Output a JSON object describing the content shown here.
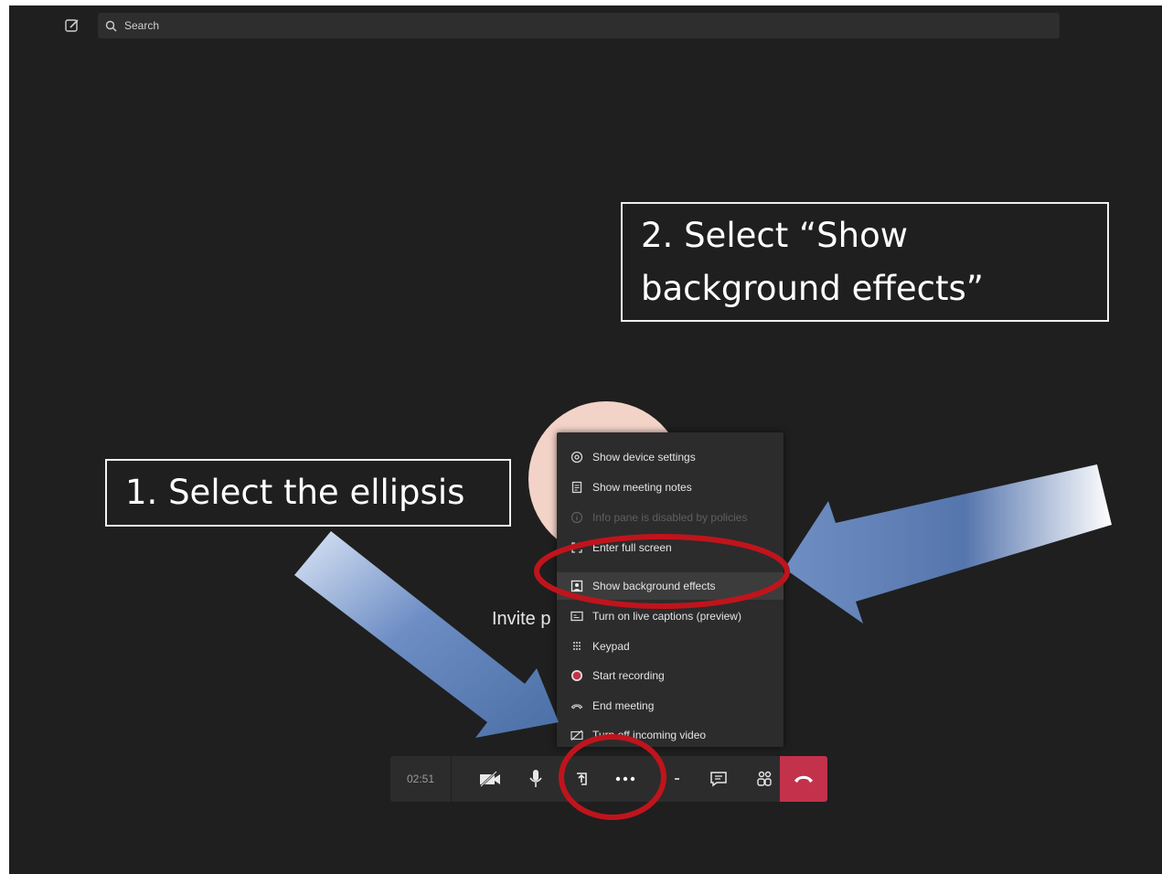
{
  "search": {
    "placeholder": "Search"
  },
  "callouts": {
    "step2_line1": "2. Select “Show",
    "step2_line2": "background effects”",
    "step1": "1. Select the ellipsis"
  },
  "stage": {
    "invite_text": "Invite p"
  },
  "menu": {
    "items": [
      {
        "label": "Show device settings",
        "icon": "gear-icon",
        "disabled": false
      },
      {
        "label": "Show meeting notes",
        "icon": "notes-icon",
        "disabled": false
      },
      {
        "label": "Info pane is disabled by policies",
        "icon": "info-icon",
        "disabled": true
      },
      {
        "label": "Enter full screen",
        "icon": "fullscreen-icon",
        "disabled": false
      },
      {
        "label": "Show background effects",
        "icon": "background-effects-icon",
        "disabled": false
      },
      {
        "label": "Turn on live captions (preview)",
        "icon": "captions-icon",
        "disabled": false
      },
      {
        "label": "Keypad",
        "icon": "keypad-icon",
        "disabled": false
      },
      {
        "label": "Start recording",
        "icon": "record-icon",
        "disabled": false
      },
      {
        "label": "End meeting",
        "icon": "end-meeting-icon",
        "disabled": false
      },
      {
        "label": "Turn off incoming video",
        "icon": "video-off-icon",
        "disabled": false
      }
    ]
  },
  "toolbar": {
    "timer": "02:51",
    "buttons": [
      "camera-off-icon",
      "microphone-icon",
      "share-icon",
      "more-options-icon",
      "raise-hand-icon",
      "chat-icon",
      "participants-icon",
      "hang-up-icon"
    ]
  },
  "colors": {
    "background": "#1f1f1f",
    "hangup": "#c4314b",
    "highlight_ring": "#c0141c",
    "arrow": "#4a6fa5",
    "avatar": "#f3d3c8"
  }
}
